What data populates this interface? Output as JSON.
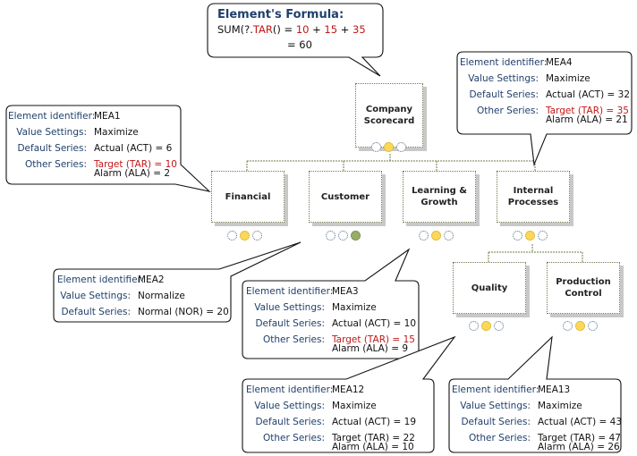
{
  "formula": {
    "title": "Element's Formula:",
    "prefix": "SUM(?.",
    "func": "TAR",
    "paren": "()",
    "eq": " = ",
    "a": "10",
    "plus1": " + ",
    "b": "15",
    "plus2": " + ",
    "c": "35",
    "result": "= 60"
  },
  "labels": {
    "id": "Element identifier:",
    "value": "Value Settings:",
    "default": "Default Series:",
    "other": "Other Series:"
  },
  "nodes": {
    "root": {
      "line1": "Company",
      "line2": "Scorecard",
      "lights": [
        "off",
        "yellow",
        "off"
      ]
    },
    "financial": {
      "line1": "Financial",
      "line2": "",
      "lights": [
        "off",
        "yellow",
        "off"
      ]
    },
    "customer": {
      "line1": "Customer",
      "line2": "",
      "lights": [
        "off",
        "off",
        "green"
      ]
    },
    "learning": {
      "line1": "Learning &",
      "line2": "Growth",
      "lights": [
        "off",
        "yellow",
        "off"
      ]
    },
    "internal": {
      "line1": "Internal",
      "line2": "Processes",
      "lights": [
        "off",
        "yellow",
        "off"
      ]
    },
    "quality": {
      "line1": "Quality",
      "line2": "",
      "lights": [
        "off",
        "yellow",
        "off"
      ]
    },
    "production": {
      "line1": "Production",
      "line2": "Control",
      "lights": [
        "off",
        "yellow",
        "off"
      ]
    }
  },
  "callouts": {
    "mea1": {
      "id": "MEA1",
      "value": "Maximize",
      "default": "Actual (ACT) = 6",
      "other": "Target (TAR) = 10",
      "other2": "Alarm (ALA) = 2"
    },
    "mea4": {
      "id": "MEA4",
      "value": "Maximize",
      "default": "Actual (ACT) = 32",
      "other": "Target (TAR) = 35",
      "other2": "Alarm (ALA) = 21"
    },
    "mea2": {
      "id": "MEA2",
      "value": "Normalize",
      "default": "Normal (NOR) = 20"
    },
    "mea3": {
      "id": "MEA3",
      "value": "Maximize",
      "default": "Actual (ACT) = 10",
      "other": "Target (TAR) = 15",
      "other2": "Alarm (ALA) = 9"
    },
    "mea12": {
      "id": "MEA12",
      "value": "Maximize",
      "default": "Actual (ACT) = 19",
      "other": "Target (TAR) = 22",
      "other2": "Alarm (ALA) = 10"
    },
    "mea13": {
      "id": "MEA13",
      "value": "Maximize",
      "default": "Actual (ACT) = 43",
      "other": "Target (TAR) = 47",
      "other2": "Alarm (ALA) = 26"
    }
  },
  "colors": {
    "highlight": "#c01818",
    "label": "#1f3f6b",
    "yellow": "#fbd85a",
    "green": "#98ad6a"
  }
}
